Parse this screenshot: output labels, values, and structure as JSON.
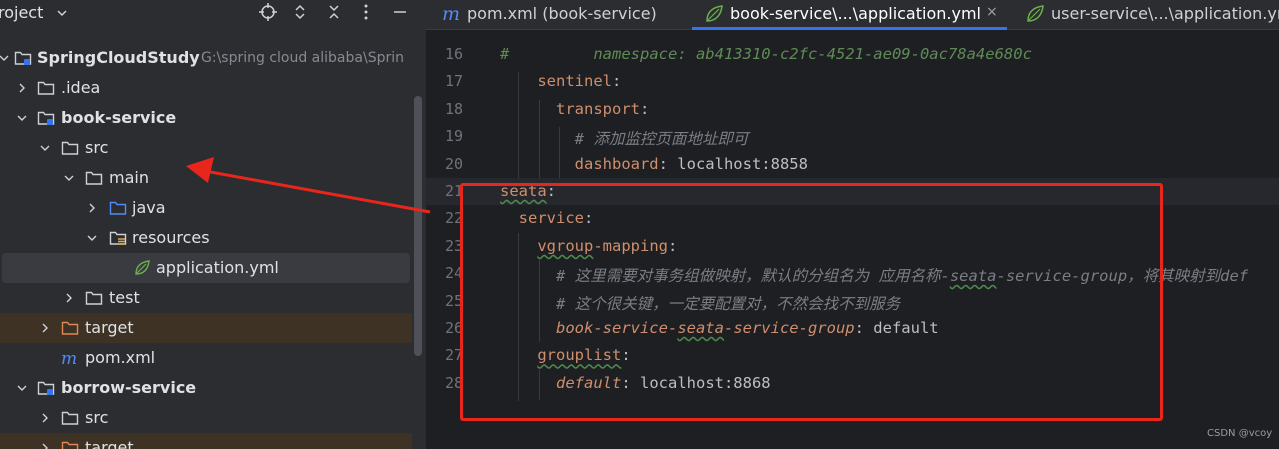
{
  "project_panel": {
    "title": "roject",
    "tree": [
      {
        "label": "SpringCloudStudy",
        "path": "G:\\spring cloud alibaba\\Sprin",
        "icon": "module-folder-icon",
        "expanded": true,
        "bold": true
      },
      {
        "label": ".idea",
        "icon": "folder-icon",
        "expanded": false
      },
      {
        "label": "book-service",
        "icon": "module-folder-icon",
        "expanded": true,
        "bold": true
      },
      {
        "label": "src",
        "icon": "folder-icon",
        "expanded": true
      },
      {
        "label": "main",
        "icon": "folder-icon",
        "expanded": true
      },
      {
        "label": "java",
        "icon": "source-folder-icon",
        "expanded": false
      },
      {
        "label": "resources",
        "icon": "resources-folder-icon",
        "expanded": true
      },
      {
        "label": "application.yml",
        "icon": "spring-leaf-icon",
        "selected": true
      },
      {
        "label": "test",
        "icon": "folder-icon",
        "expanded": false
      },
      {
        "label": "target",
        "icon": "excluded-folder-icon",
        "expanded": false
      },
      {
        "label": "pom.xml",
        "icon": "maven-icon"
      },
      {
        "label": "borrow-service",
        "icon": "module-folder-icon",
        "expanded": true,
        "bold": true
      },
      {
        "label": "src",
        "icon": "folder-icon",
        "expanded": false
      },
      {
        "label": "target",
        "icon": "excluded-folder-icon",
        "expanded": false
      }
    ]
  },
  "tabs": [
    {
      "label": "pom.xml (book-service)",
      "icon": "maven-icon"
    },
    {
      "label": "book-service\\...\\application.yml",
      "icon": "spring-leaf-icon",
      "active": true,
      "close": "×"
    },
    {
      "label": "user-service\\...\\application.ym",
      "icon": "spring-leaf-icon"
    }
  ],
  "editor": {
    "lines": [
      {
        "num": "16",
        "tokens": [
          {
            "t": "#",
            "c": "cm"
          },
          {
            "t": "         namespace: ab413310-c2fc-4521-ae09-0ac78a4e680c",
            "c": "cm"
          }
        ]
      },
      {
        "num": "17",
        "tokens": [
          {
            "t": "    sentinel",
            "c": "k"
          },
          {
            "t": ":",
            "c": "p"
          }
        ]
      },
      {
        "num": "18",
        "tokens": [
          {
            "t": "      transport",
            "c": "k"
          },
          {
            "t": ":",
            "c": "p"
          }
        ]
      },
      {
        "num": "19",
        "tokens": [
          {
            "t": "        # 添加监控页面地址即可",
            "c": "c"
          }
        ]
      },
      {
        "num": "20",
        "tokens": [
          {
            "t": "        dashboard",
            "c": "k"
          },
          {
            "t": ": localhost:8858",
            "c": "v"
          }
        ]
      },
      {
        "num": "21",
        "tokens": [
          {
            "t": "seata",
            "c": "k typo"
          },
          {
            "t": ":",
            "c": "p"
          }
        ]
      },
      {
        "num": "22",
        "tokens": [
          {
            "t": "  service",
            "c": "k"
          },
          {
            "t": ":",
            "c": "p"
          }
        ]
      },
      {
        "num": "23",
        "tokens": [
          {
            "t": "    ",
            "c": "p"
          },
          {
            "t": "vgroup",
            "c": "k typo"
          },
          {
            "t": "-mapping",
            "c": "k"
          },
          {
            "t": ":",
            "c": "p"
          }
        ]
      },
      {
        "num": "24",
        "tokens": [
          {
            "t": "      # 这里需要对事务组做映射，默认的分组名为 应用名称-",
            "c": "c"
          },
          {
            "t": "seata",
            "c": "c typo"
          },
          {
            "t": "-service-group，将其映射到def",
            "c": "c"
          }
        ]
      },
      {
        "num": "25",
        "tokens": [
          {
            "t": "      # 这个很关键，一定要配置对，不然会找不到服务",
            "c": "c"
          }
        ]
      },
      {
        "num": "26",
        "tokens": [
          {
            "t": "      book-service-",
            "c": "ki"
          },
          {
            "t": "seata",
            "c": "ki typo"
          },
          {
            "t": "-service-group",
            "c": "ki"
          },
          {
            "t": ": default",
            "c": "v"
          }
        ]
      },
      {
        "num": "27",
        "tokens": [
          {
            "t": "    ",
            "c": "p"
          },
          {
            "t": "grouplist",
            "c": "k typo"
          },
          {
            "t": ":",
            "c": "p"
          }
        ]
      },
      {
        "num": "28",
        "tokens": [
          {
            "t": "      default",
            "c": "ki"
          },
          {
            "t": ": localhost:8868",
            "c": "v"
          }
        ]
      }
    ]
  },
  "watermark": "CSDN @vcoy",
  "colors": {
    "highlight_box": "#e8261c",
    "arrow": "#e8261c",
    "active_tab_underline": "#3574f0"
  }
}
